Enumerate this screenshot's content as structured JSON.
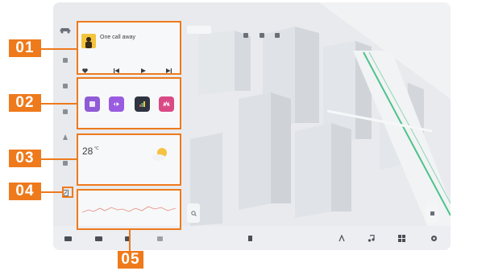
{
  "callouts": [
    {
      "number": "01"
    },
    {
      "number": "02"
    },
    {
      "number": "03"
    },
    {
      "number": "04"
    },
    {
      "number": "05"
    }
  ],
  "status_bar": {
    "left_items": [
      "",
      "",
      "",
      ""
    ],
    "center": "",
    "right_items": [
      "",
      "",
      ""
    ]
  },
  "map": {
    "chip_label": "",
    "left_button_label": "",
    "right_button_label": ""
  },
  "music_card": {
    "title": "",
    "song_title": "One call away",
    "artist": ""
  },
  "apps_card": {
    "title": "",
    "apps": [
      {
        "label": "",
        "color": "#8f5bd6"
      },
      {
        "label": "",
        "color": "#9a5be0"
      },
      {
        "label": "",
        "color": "#2f3440"
      },
      {
        "label": "",
        "color": "#d94a85"
      }
    ]
  },
  "weather_card": {
    "title": "",
    "temperature": "28",
    "unit": "°C",
    "condition": "",
    "details": [
      "",
      ""
    ]
  },
  "trend_card": {
    "title": "",
    "footer": ""
  },
  "dock": {
    "left_value": "",
    "right_value": ""
  },
  "colors": {
    "accent": "#ee7a1c",
    "route": "#4cc38a"
  }
}
